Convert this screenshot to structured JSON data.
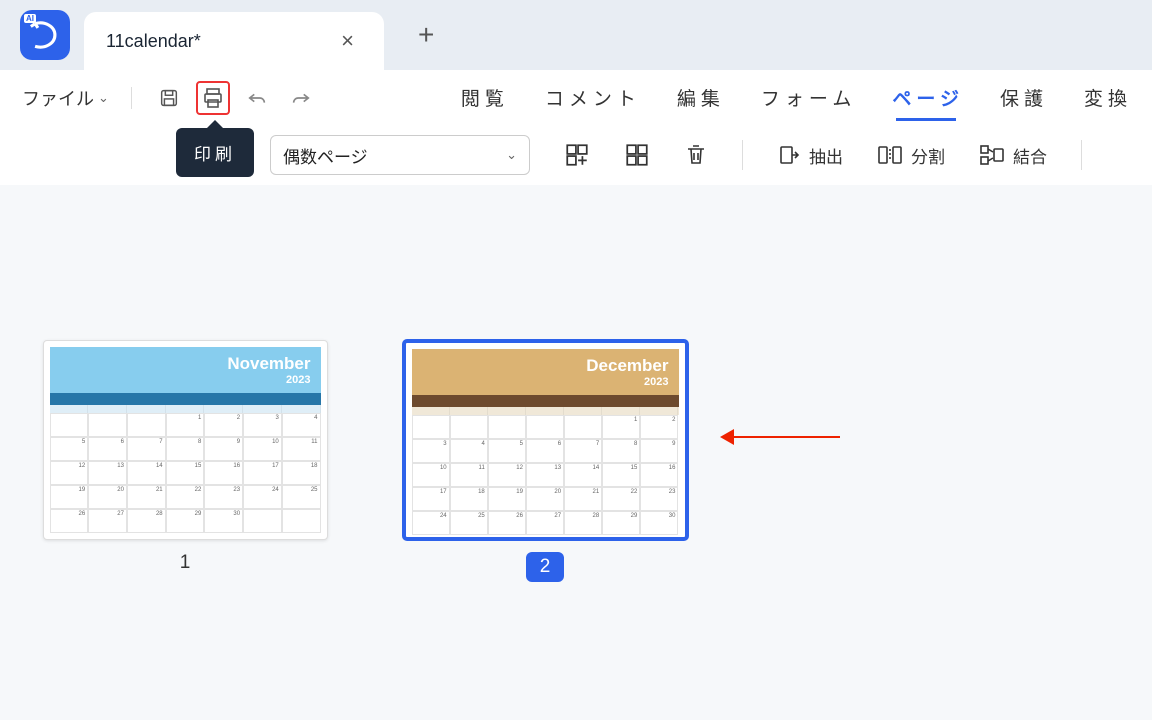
{
  "tab": {
    "title": "11calendar*"
  },
  "menubar": {
    "file_label": "ファイル",
    "tabs": {
      "browse": "閲覧",
      "comment": "コメント",
      "edit": "編集",
      "form": "フォーム",
      "page": "ページ",
      "protect": "保護",
      "convert": "変換"
    }
  },
  "tooltip": {
    "print": "印刷"
  },
  "toolbar": {
    "select_value": "偶数ページ",
    "extract": "抽出",
    "split": "分割",
    "merge": "結合"
  },
  "pages": [
    {
      "month": "November",
      "year": "2023",
      "num": "1"
    },
    {
      "month": "December",
      "year": "2023",
      "num": "2"
    }
  ],
  "icons": {
    "save": "save-icon",
    "print": "print-icon",
    "undo": "undo-icon",
    "redo": "redo-icon"
  }
}
